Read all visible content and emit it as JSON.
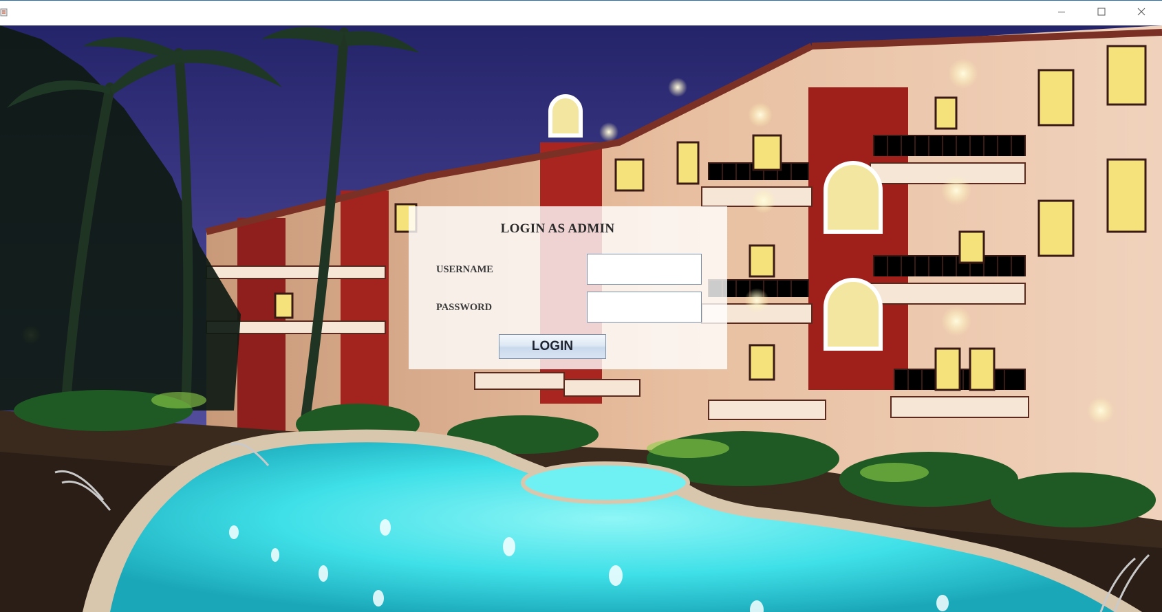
{
  "window": {
    "icon": "java-app-icon",
    "controls": [
      "minimize-icon",
      "maximize-icon",
      "close-icon"
    ]
  },
  "background": {
    "image": "resort-pool-night-photo"
  },
  "login": {
    "title": "LOGIN AS ADMIN",
    "username_label": "USERNAME",
    "password_label": "PASSWORD",
    "username_value": "",
    "password_value": "",
    "button_label": "LOGIN"
  },
  "colors": {
    "pool": "#3fe0e8",
    "sky": "#2f2c6e",
    "panel": "#ffffff",
    "button": "#d8e4f2"
  }
}
